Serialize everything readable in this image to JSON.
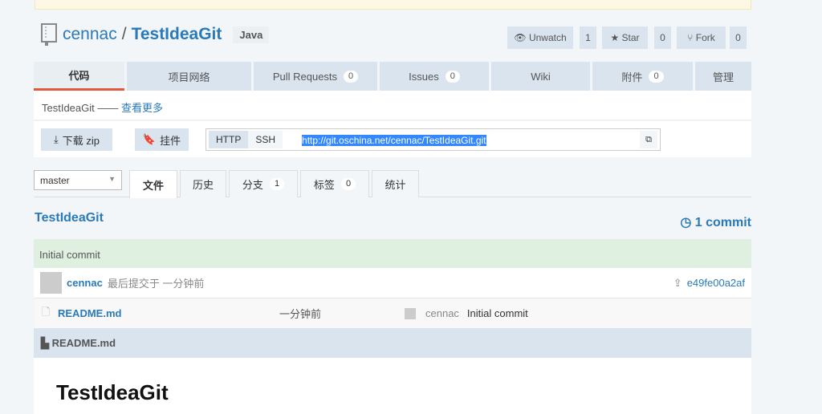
{
  "repo": {
    "owner": "cennac",
    "separator": "/",
    "name": "TestIdeaGit",
    "language": "Java"
  },
  "actions": {
    "watch": "Unwatch",
    "watch_count": "1",
    "star": "Star",
    "star_count": "0",
    "fork": "Fork",
    "fork_count": "0"
  },
  "tabs": [
    {
      "label": "代码"
    },
    {
      "label": "项目网络"
    },
    {
      "label": "Pull Requests",
      "count": "0"
    },
    {
      "label": "Issues",
      "count": "0"
    },
    {
      "label": "Wiki"
    },
    {
      "label": "附件",
      "count": "0"
    },
    {
      "label": "管理"
    }
  ],
  "description": {
    "text": "TestIdeaGit ——",
    "more": "查看更多"
  },
  "clone": {
    "download": "下载 zip",
    "widget": "挂件",
    "http": "HTTP",
    "ssh": "SSH",
    "url": "http://git.oschina.net/cennac/TestIdeaGit.git"
  },
  "branch": {
    "selected": "master"
  },
  "subtabs": [
    {
      "label": "文件"
    },
    {
      "label": "历史"
    },
    {
      "label": "分支",
      "count": "1"
    },
    {
      "label": "标签",
      "count": "0"
    },
    {
      "label": "统计"
    }
  ],
  "tree": {
    "title": "TestIdeaGit",
    "commits": "1 commit",
    "commit_message": "Initial commit",
    "author": "cennac",
    "last_commit": "最后提交于 一分钟前",
    "hash": "e49fe00a2af"
  },
  "files": [
    {
      "name": "README.md",
      "time": "一分钟前",
      "author": "cennac",
      "message": "Initial commit"
    }
  ],
  "readme": {
    "header": "README.md",
    "heading": "TestIdeaGit"
  }
}
